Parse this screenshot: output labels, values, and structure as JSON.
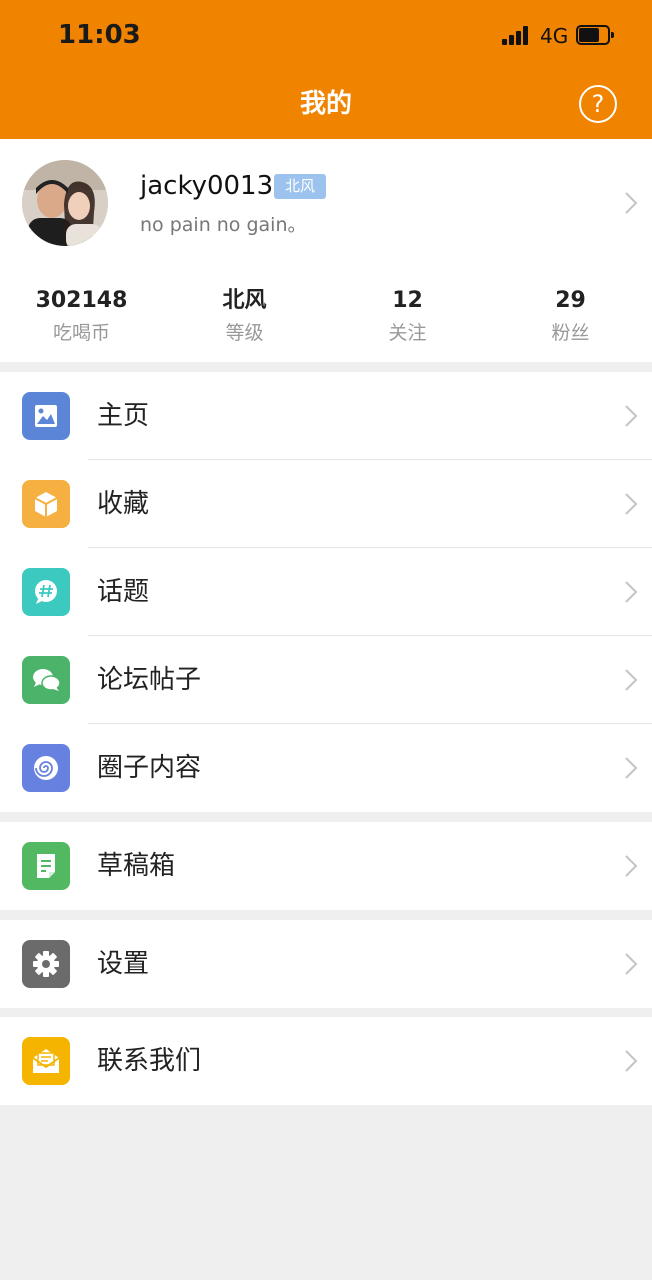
{
  "status_bar": {
    "time": "11:03",
    "network": "4G"
  },
  "header": {
    "title": "我的",
    "help_icon": "question-circle-icon"
  },
  "profile": {
    "username": "jacky0013",
    "level_badge": "北风",
    "motto": "no pain no gain。",
    "stats": [
      {
        "value": "302148",
        "label": "吃喝币"
      },
      {
        "value": "北风",
        "label": "等级"
      },
      {
        "value": "12",
        "label": "关注"
      },
      {
        "value": "29",
        "label": "粉丝"
      }
    ]
  },
  "menu": {
    "home": {
      "label": "主页",
      "icon": "picture-icon",
      "color": "#5b86d8"
    },
    "favorites": {
      "label": "收藏",
      "icon": "box-icon",
      "color": "#f5b041"
    },
    "topics": {
      "label": "话题",
      "icon": "hashtag-bubble-icon",
      "color": "#3cc9c0"
    },
    "forum_posts": {
      "label": "论坛帖子",
      "icon": "chat-bubbles-icon",
      "color": "#4cb36a"
    },
    "circle_content": {
      "label": "圈子内容",
      "icon": "spiral-icon",
      "color": "#6781e0"
    },
    "drafts": {
      "label": "草稿箱",
      "icon": "document-icon",
      "color": "#52b962"
    },
    "settings": {
      "label": "设置",
      "icon": "gear-icon",
      "color": "#6b6b6b"
    },
    "contact": {
      "label": "联系我们",
      "icon": "envelope-icon",
      "color": "#f5b400"
    }
  },
  "theme": {
    "header_bg": "#f08300",
    "badge_bg": "#9cc2ee",
    "page_bg": "#efefef"
  }
}
